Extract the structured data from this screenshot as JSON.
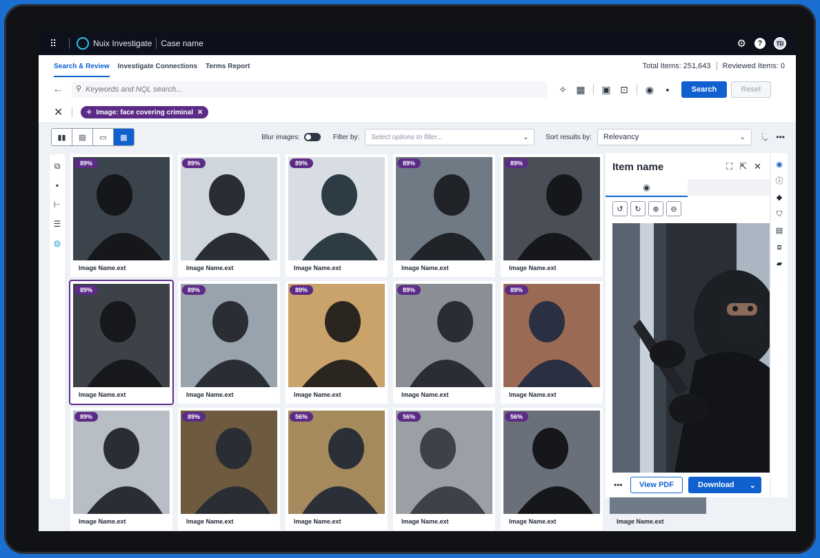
{
  "app": {
    "name": "Nuix Investigate",
    "case": "Case name",
    "avatar_initials": "TD"
  },
  "tabs": [
    {
      "label": "Search & Review",
      "active": true
    },
    {
      "label": "Investigate Connections",
      "active": false
    },
    {
      "label": "Terms Report",
      "active": false
    }
  ],
  "totals": {
    "total": "Total Items: 251,643",
    "reviewed": "Reviewed Items: 0"
  },
  "search": {
    "placeholder": "Keywords and NQL search...",
    "search_label": "Search",
    "reset_label": "Reset"
  },
  "filter_chip": {
    "label": "Image: face covering criminal"
  },
  "view": {
    "blur_label": "Blur images:",
    "filter_label": "Filter by:",
    "filter_placeholder": "Select options to filter...",
    "sort_label": "Sort results by:",
    "sort_value": "Relevancy"
  },
  "cards": [
    {
      "score": "89%",
      "name": "Image Name.ext"
    },
    {
      "score": "89%",
      "name": "Image Name.ext"
    },
    {
      "score": "89%",
      "name": "Image Name.ext"
    },
    {
      "score": "89%",
      "name": "Image Name.ext"
    },
    {
      "score": "89%",
      "name": "Image Name.ext"
    },
    {
      "score": "89%",
      "name": "Image Name.ext"
    },
    {
      "score": "89%",
      "name": "Image Name.ext"
    },
    {
      "score": "89%",
      "name": "Image Name.ext"
    },
    {
      "score": "89%",
      "name": "Image Name.ext"
    },
    {
      "score": "89%",
      "name": "Image Name.ext"
    },
    {
      "score": "89%",
      "name": "Image Name.ext"
    },
    {
      "score": "89%",
      "name": "Image Name.ext"
    },
    {
      "score": "56%",
      "name": "Image Name.ext"
    },
    {
      "score": "56%",
      "name": "Image Name.ext"
    },
    {
      "score": "56%",
      "name": "Image Name.ext"
    }
  ],
  "partial_card": {
    "name": "Image Name.ext"
  },
  "panel": {
    "title": "Item name",
    "view_pdf": "View PDF",
    "download": "Download"
  },
  "colors": {
    "accent": "#1060cf",
    "chip": "#5c2b86",
    "topbar": "#0c111c"
  }
}
